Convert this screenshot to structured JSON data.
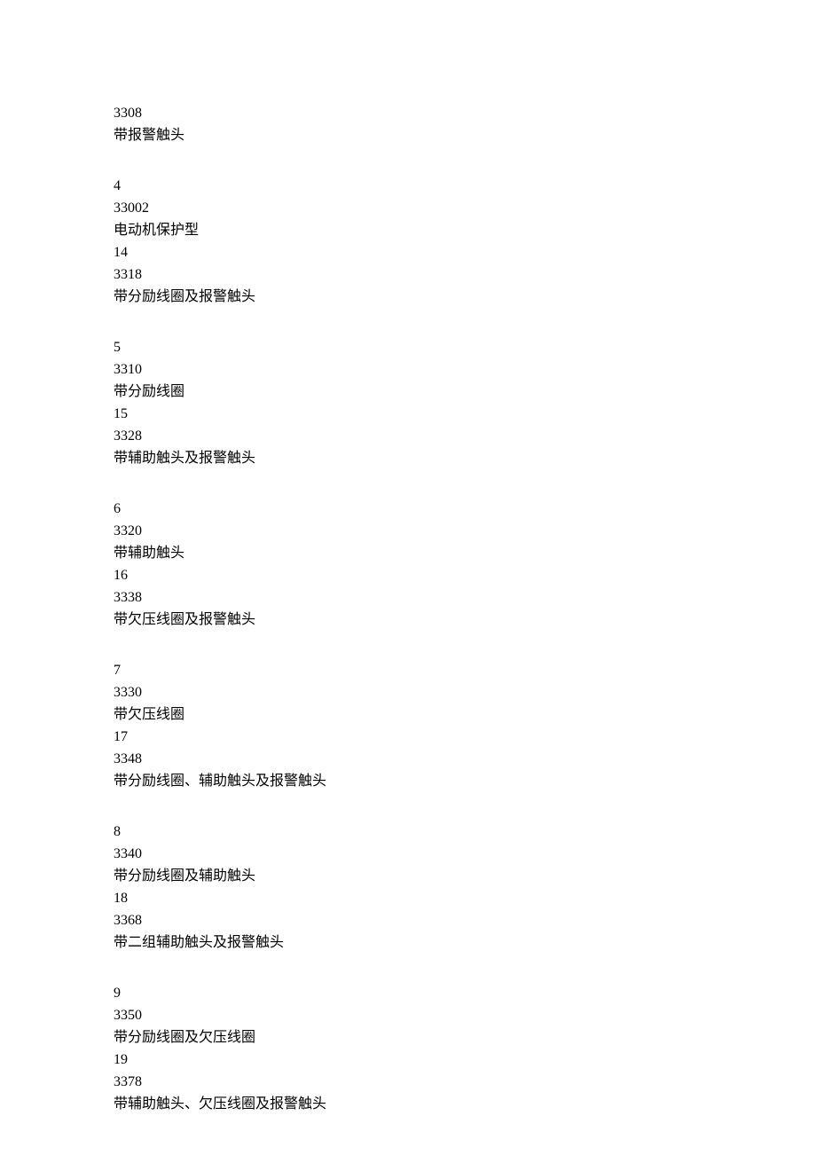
{
  "groups": [
    {
      "lines": [
        "3308",
        "带报警触头"
      ]
    },
    {
      "lines": [
        "4",
        "33002",
        "电动机保护型",
        "14",
        "3318",
        "带分励线圈及报警触头"
      ]
    },
    {
      "lines": [
        "5",
        "3310",
        "带分励线圈",
        "15",
        "3328",
        "带辅助触头及报警触头"
      ]
    },
    {
      "lines": [
        "6",
        "3320",
        "带辅助触头",
        "16",
        "3338",
        "带欠压线圈及报警触头"
      ]
    },
    {
      "lines": [
        "7",
        "3330",
        "带欠压线圈",
        "17",
        "3348",
        "带分励线圈、辅助触头及报警触头"
      ]
    },
    {
      "lines": [
        "8",
        "3340",
        "带分励线圈及辅助触头",
        "18",
        "3368",
        "带二组辅助触头及报警触头"
      ]
    },
    {
      "lines": [
        "9",
        "3350",
        "带分励线圈及欠压线圈",
        "19",
        "3378",
        "带辅助触头、欠压线圈及报警触头"
      ]
    }
  ]
}
